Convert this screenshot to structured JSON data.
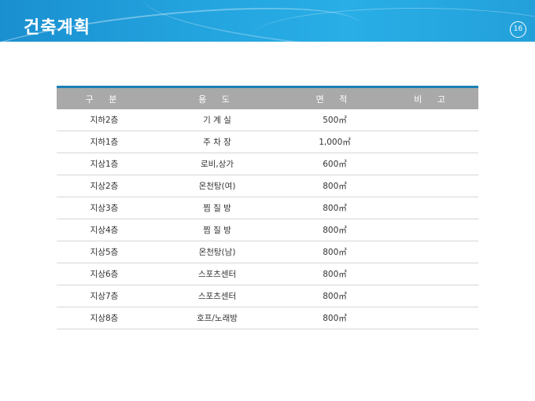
{
  "slide": {
    "title": "건축계획",
    "page_number": "16"
  },
  "table": {
    "headers": [
      "구 분",
      "용 도",
      "면 적",
      "비 고"
    ],
    "rows": [
      [
        "지하2층",
        "기 계 실",
        "500㎡",
        ""
      ],
      [
        "지하1층",
        "주 차 장",
        "1,000㎡",
        ""
      ],
      [
        "지상1층",
        "로비,상가",
        "600㎡",
        ""
      ],
      [
        "지상2층",
        "온천탕(여)",
        "800㎡",
        ""
      ],
      [
        "지상3층",
        "찜 질 방",
        "800㎡",
        ""
      ],
      [
        "지상4층",
        "찜 질 방",
        "800㎡",
        ""
      ],
      [
        "지상5층",
        "온천탕(남)",
        "800㎡",
        ""
      ],
      [
        "지상6층",
        "스포츠센터",
        "800㎡",
        ""
      ],
      [
        "지상7층",
        "스포츠센터",
        "800㎡",
        ""
      ],
      [
        "지상8층",
        "호프/노래방",
        "800㎡",
        ""
      ]
    ]
  },
  "colors": {
    "header_band": "#23a3de",
    "table_top_rule": "#1b7fb7",
    "table_header_bg": "#a9a9a9"
  }
}
